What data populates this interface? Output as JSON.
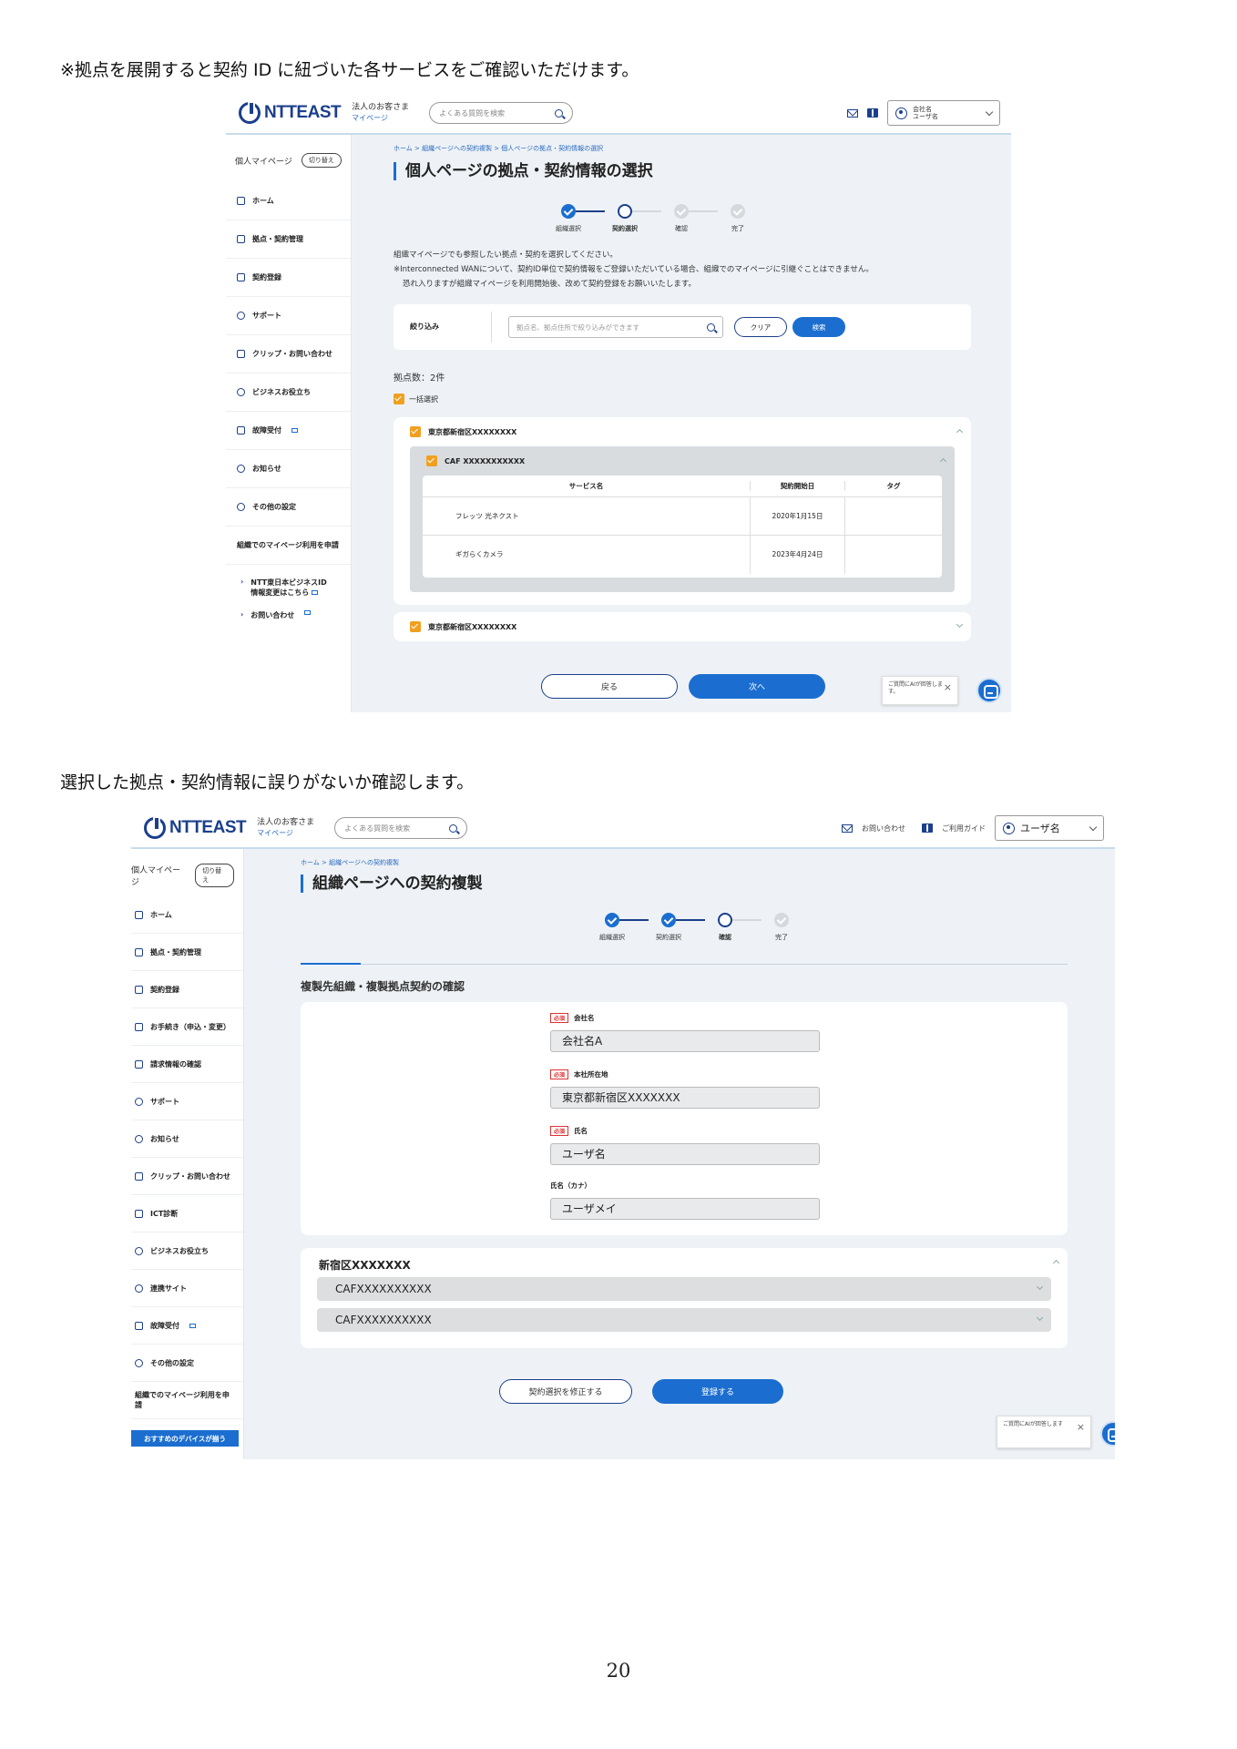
{
  "page": {
    "caption_1": "※拠点を展開すると契約 ID に紐づいた各サービスをご確認いただけます。",
    "caption_2": "選択した拠点・契約情報に誤りがないか確認します。",
    "page_number": "20"
  },
  "shot1": {
    "header": {
      "logo": "NTTEAST",
      "logo_sub_1": "法人のお客さま",
      "logo_sub_2": "マイページ",
      "search_placeholder": "よくある質問を検索",
      "user_company": "会社名",
      "user_name": "ユーザ名"
    },
    "sidebar": {
      "head": "個人マイページ",
      "switch": "切り替え",
      "items": [
        "ホーム",
        "拠点・契約管理",
        "契約登録",
        "サポート",
        "クリップ・お問い合わせ",
        "ビジネスお役立ち",
        "故障受付",
        "お知らせ",
        "その他の設定"
      ],
      "apply": "組織でのマイページ利用を申請",
      "link_1a": "NTT東日本ビジネスID",
      "link_1b": "情報変更はこちら",
      "link_2": "お問い合わせ"
    },
    "main": {
      "breadcrumb": "ホーム > 組織ページへの契約複製 > 個人ページの拠点・契約情報の選択",
      "title": "個人ページの拠点・契約情報の選択",
      "steps": [
        "組織選択",
        "契約選択",
        "確認",
        "完了"
      ],
      "intro_1": "組織マイページでも参照したい拠点・契約を選択してください。",
      "intro_2": "※Interconnected WANについて、契約ID単位で契約情報をご登録いただいている場合、組織でのマイページに引継ぐことはできません。",
      "intro_3": "恐れ入りますが組織マイページを利用開始後、改めて契約登録をお願いいたします。",
      "filter_label": "絞り込み",
      "filter_placeholder": "拠点名、拠点住所で絞り込みができます",
      "clear_label": "クリア",
      "search_label": "検索",
      "count_text": "拠点数：2件",
      "select_all": "一括選択",
      "site_1": "東京都新宿区XXXXXXXX",
      "caf_1": "CAF XXXXXXXXXXX",
      "table_headers": [
        "サービス名",
        "契約開始日",
        "タグ"
      ],
      "rows": [
        {
          "service": "フレッツ 光ネクスト",
          "date": "2020年1月15日",
          "tag": ""
        },
        {
          "service": "ギガらくカメラ",
          "date": "2023年4月24日",
          "tag": ""
        }
      ],
      "site_2": "東京都新宿区XXXXXXXX",
      "back_label": "戻る",
      "next_label": "次へ",
      "chat_text": "ご質問にAIが回答します。"
    }
  },
  "shot2": {
    "header": {
      "logo": "NTTEAST",
      "logo_sub_1": "法人のお客さま",
      "logo_sub_2": "マイページ",
      "search_placeholder": "よくある質問を検索",
      "contact": "お問い合わせ",
      "guide": "ご利用ガイド",
      "user_name": "ユーザ名"
    },
    "sidebar": {
      "head": "個人マイページ",
      "switch": "切り替え",
      "items": [
        "ホーム",
        "拠点・契約管理",
        "契約登録",
        "お手続き（申込・変更）",
        "請求情報の確認",
        "サポート",
        "お知らせ",
        "クリップ・お問い合わせ",
        "ICT診断",
        "ビジネスお役立ち",
        "連携サイト",
        "故障受付",
        "その他の設定"
      ],
      "apply": "組織でのマイページ利用を申請",
      "device_button": "おすすめのデバイスが揃う"
    },
    "main": {
      "breadcrumb": "ホーム > 組織ページへの契約複製",
      "title": "組織ページへの契約複製",
      "steps": [
        "組織選択",
        "契約選択",
        "確認",
        "完了"
      ],
      "section_title": "複製先組織・複製拠点契約の確認",
      "required": "必須",
      "fields": [
        {
          "label": "会社名",
          "value": "会社名A",
          "required": true
        },
        {
          "label": "本社所在地",
          "value": "東京都新宿区XXXXXXX",
          "required": true
        },
        {
          "label": "氏名",
          "value": "ユーザ名",
          "required": true
        },
        {
          "label": "氏名（カナ）",
          "value": "ユーザメイ",
          "required": false
        }
      ],
      "site": "新宿区XXXXXXX",
      "contracts": [
        "CAFXXXXXXXXXX",
        "CAFXXXXXXXXXX"
      ],
      "fix_label": "契約選択を修正する",
      "register_label": "登録する",
      "chat_text": "ご質問にAIが回答します"
    }
  }
}
